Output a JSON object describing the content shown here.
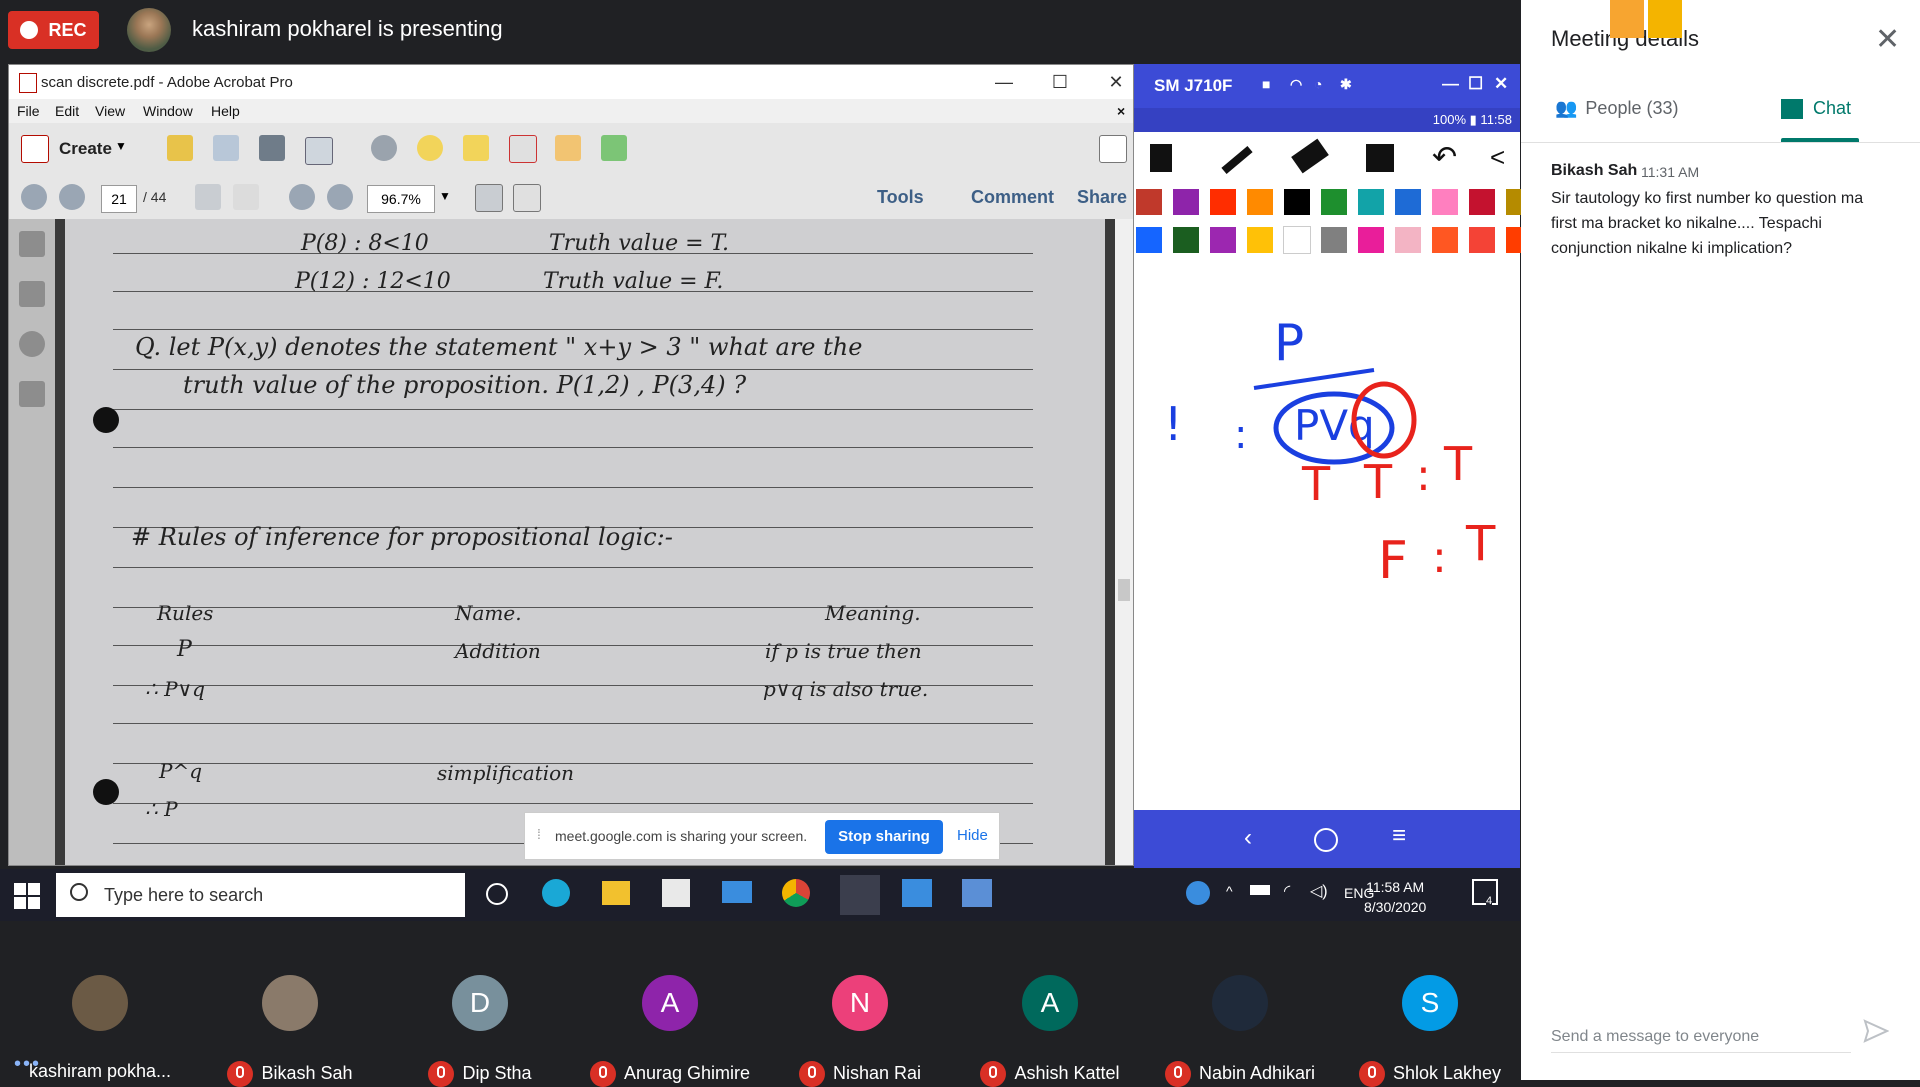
{
  "meet": {
    "rec_label": "REC",
    "presenter_text": "kashiram pokharel is presenting"
  },
  "acrobat": {
    "title": "scan discrete.pdf - Adobe Acrobat Pro",
    "menu": [
      "File",
      "Edit",
      "View",
      "Window",
      "Help"
    ],
    "create_label": "Create",
    "page_current": "21",
    "page_total": "/ 44",
    "zoom": "96.7%",
    "right_links": [
      "Tools",
      "Comment",
      "Share"
    ]
  },
  "document": {
    "lines": [
      "P(8) : 8<10",
      "Truth value = T.",
      "P(12) : 12<10",
      "Truth value = F.",
      "Q. let P(x,y) denotes the statement \" x+y > 3 \" what are the",
      "truth value of the proposition. P(1,2) , P(3,4) ?",
      "# Rules of inference for propositional logic:-",
      "Rules",
      "Name.",
      "Meaning.",
      "P",
      "Addition",
      "if p is true then",
      "∴ P∨q",
      "p∨q is also true.",
      "P^q",
      "simplification",
      "∴ P"
    ]
  },
  "share_bar": {
    "text": "meet.google.com is sharing your screen.",
    "stop_label": "Stop sharing",
    "hide_label": "Hide"
  },
  "phone": {
    "title": "SM J710F",
    "status": "100% ▮ 11:58",
    "palette_row1": [
      "#c0392b",
      "#8e24aa",
      "#ff2d00",
      "#ff8a00",
      "#000000",
      "#1e8f2e",
      "#12a3a8",
      "#1e6bd6",
      "#ff7fbf",
      "#c4122f",
      "#b58b00"
    ],
    "palette_row2": [
      "#1565ff",
      "#1b5e20",
      "#9c27b0",
      "#ffc107",
      "#ffffff",
      "#808080",
      "#e91e9a",
      "#f3b4c4",
      "#ff5722",
      "#f44336",
      "#ff3d00"
    ],
    "ink_blue": "#1a3fe0",
    "ink_red": "#e8231c",
    "scribbles": [
      "!",
      "P",
      ":",
      "PVq",
      "T",
      "T",
      ":",
      "T",
      "F",
      ":",
      "T"
    ]
  },
  "taskbar": {
    "search_placeholder": "Type here to search",
    "lang": "ENG",
    "time": "11:58 AM",
    "date": "8/30/2020",
    "notification_count": "4"
  },
  "participants": [
    {
      "name": "kashiram pokha...",
      "initial": "",
      "color": "#6b5a45",
      "muted": false
    },
    {
      "name": "Bikash Sah",
      "initial": "",
      "color": "#8a7a6a",
      "muted": true
    },
    {
      "name": "Dip Stha",
      "initial": "D",
      "color": "#78909c",
      "muted": true
    },
    {
      "name": "Anurag Ghimire",
      "initial": "A",
      "color": "#8e24aa",
      "muted": true
    },
    {
      "name": "Nishan Rai",
      "initial": "N",
      "color": "#ec407a",
      "muted": true
    },
    {
      "name": "Ashish Kattel",
      "initial": "A",
      "color": "#00695c",
      "muted": true
    },
    {
      "name": "Nabin Adhikari",
      "initial": "",
      "color": "#1f2a3a",
      "muted": true
    },
    {
      "name": "Shlok Lakhey",
      "initial": "S",
      "color": "#039be5",
      "muted": true
    }
  ],
  "panel": {
    "title": "Meeting details",
    "people_tab": "People (33)",
    "chat_tab": "Chat",
    "messages": [
      {
        "author": "Bikash Sah",
        "time": "11:31 AM",
        "text": "Sir tautology ko first number ko question ma first ma bracket ko nikalne.... Tespachi conjunction nikalne ki implication?"
      }
    ],
    "input_placeholder": "Send a message to everyone"
  }
}
